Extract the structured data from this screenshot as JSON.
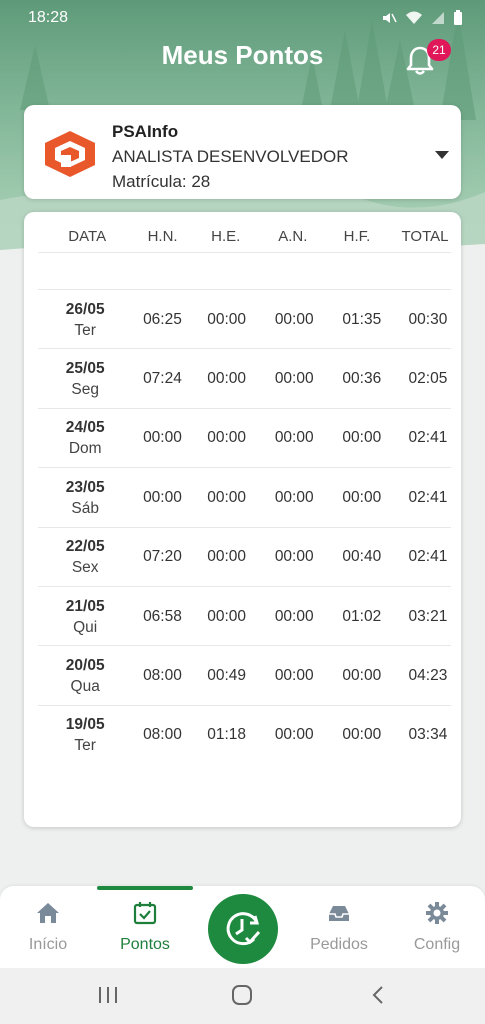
{
  "status_bar": {
    "time": "18:28"
  },
  "header": {
    "title": "Meus Pontos",
    "notification_count": "21"
  },
  "company": {
    "name": "PSAInfo",
    "role": "ANALISTA DESENVOLVEDOR",
    "registration": "Matrícula: 28"
  },
  "table": {
    "headers": [
      "DATA",
      "H.N.",
      "H.E.",
      "A.N.",
      "H.F.",
      "TOTAL"
    ],
    "rows": [
      {
        "date": "26/05",
        "weekday": "Ter",
        "hn": "06:25",
        "he": "00:00",
        "an": "00:00",
        "hf": "01:35",
        "total": "00:30"
      },
      {
        "date": "25/05",
        "weekday": "Seg",
        "hn": "07:24",
        "he": "00:00",
        "an": "00:00",
        "hf": "00:36",
        "total": "02:05"
      },
      {
        "date": "24/05",
        "weekday": "Dom",
        "hn": "00:00",
        "he": "00:00",
        "an": "00:00",
        "hf": "00:00",
        "total": "02:41"
      },
      {
        "date": "23/05",
        "weekday": "Sáb",
        "hn": "00:00",
        "he": "00:00",
        "an": "00:00",
        "hf": "00:00",
        "total": "02:41"
      },
      {
        "date": "22/05",
        "weekday": "Sex",
        "hn": "07:20",
        "he": "00:00",
        "an": "00:00",
        "hf": "00:40",
        "total": "02:41"
      },
      {
        "date": "21/05",
        "weekday": "Qui",
        "hn": "06:58",
        "he": "00:00",
        "an": "00:00",
        "hf": "01:02",
        "total": "03:21"
      },
      {
        "date": "20/05",
        "weekday": "Qua",
        "hn": "08:00",
        "he": "00:49",
        "an": "00:00",
        "hf": "00:00",
        "total": "04:23"
      },
      {
        "date": "19/05",
        "weekday": "Ter",
        "hn": "08:00",
        "he": "01:18",
        "an": "00:00",
        "hf": "00:00",
        "total": "03:34"
      }
    ]
  },
  "bottom_nav": {
    "items": [
      {
        "label": "Início",
        "icon": "home-icon"
      },
      {
        "label": "Pontos",
        "icon": "calendar-check-icon"
      },
      {
        "label": "Pedidos",
        "icon": "inbox-icon"
      },
      {
        "label": "Config",
        "icon": "gear-icon"
      }
    ],
    "active": "Pontos",
    "fab_icon": "clock-check-icon"
  },
  "colors": {
    "accent": "#1e8a3f",
    "badge": "#e0185a",
    "logo": "#e8582a"
  }
}
